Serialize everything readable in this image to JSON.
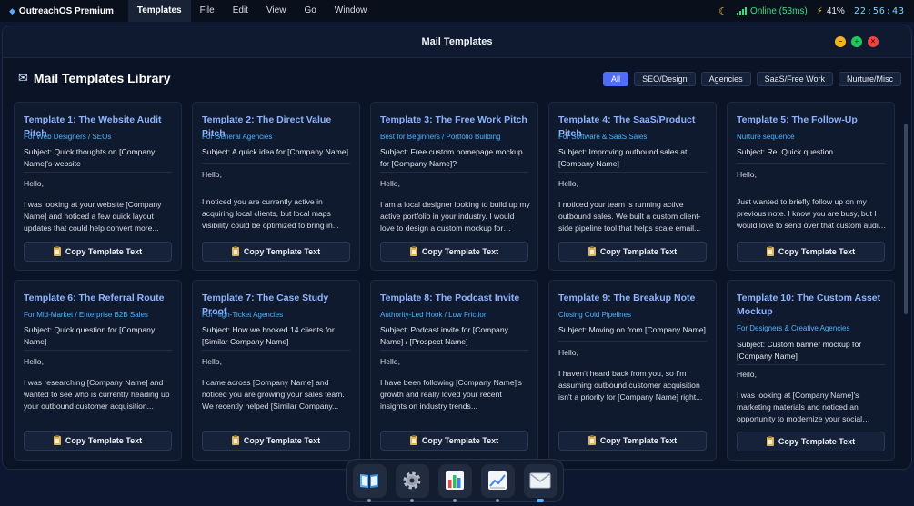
{
  "menubar": {
    "app_name": "OutreachOS Premium",
    "items": [
      "Templates",
      "File",
      "Edit",
      "View",
      "Go",
      "Window"
    ],
    "online": "Online (53ms)",
    "battery": "41%",
    "clock": "22:56:43"
  },
  "window": {
    "title": "Mail Templates",
    "buttons": {
      "minimize": "–",
      "maximize": "+",
      "close": "×"
    }
  },
  "library": {
    "title": "Mail Templates Library",
    "filters": [
      "All",
      "SEO/Design",
      "Agencies",
      "SaaS/Free Work",
      "Nurture/Misc"
    ],
    "active_filter": "All"
  },
  "copy_label": "Copy Template Text",
  "templates": [
    {
      "title": "Template 1: The Website Audit Pitch",
      "tag": "For Web Designers / SEOs",
      "subject": "Subject: Quick thoughts on [Company Name]'s website",
      "greeting": "Hello,",
      "body": "I was looking at your website [Company Name] and noticed a few quick layout updates that could help convert more..."
    },
    {
      "title": "Template 2: The Direct Value Pitch",
      "tag": "For General Agencies",
      "subject": "Subject: A quick idea for [Company Name]",
      "greeting": "Hello,",
      "body": "I noticed you are currently active in acquiring local clients, but local maps visibility could be optimized to bring in..."
    },
    {
      "title": "Template 3: The Free Work Pitch",
      "tag": "Best for Beginners / Portfolio Building",
      "subject": "Subject: Free custom homepage mockup for [Company Name]?",
      "greeting": "Hello,",
      "body": "I am a local designer looking to build up my active portfolio in your industry. I would love to design a custom mockup for [Company..."
    },
    {
      "title": "Template 4: The SaaS/Product Pitch",
      "tag": "For Software & SaaS Sales",
      "subject": "Subject: Improving outbound sales at [Company Name]",
      "greeting": "Hello,",
      "body": "I noticed your team is running active outbound sales. We built a custom client-side pipeline tool that helps scale email..."
    },
    {
      "title": "Template 5: The Follow-Up",
      "tag": "Nurture sequence",
      "subject": "Subject: Re: Quick question",
      "greeting": "Hello,",
      "body": "Just wanted to briefly follow up on my previous note. I know you are busy, but I would love to send over that custom audit ..."
    },
    {
      "title": "Template 6: The Referral Route",
      "tag": "For Mid-Market / Enterprise B2B Sales",
      "subject": "Subject: Quick question for [Company Name]",
      "greeting": "Hello,",
      "body": "I was researching [Company Name] and wanted to see who is currently heading up your outbound customer acquisition..."
    },
    {
      "title": "Template 7: The Case Study Proof",
      "tag": "For High-Ticket Agencies",
      "subject": "Subject: How we booked 14 clients for [Similar Company Name]",
      "greeting": "Hello,",
      "body": "I came across [Company Name] and noticed you are growing your sales team. We recently helped [Similar Company..."
    },
    {
      "title": "Template 8: The Podcast Invite",
      "tag": "Authority-Led Hook / Low Friction",
      "subject": "Subject: Podcast invite for [Company Name] / [Prospect Name]",
      "greeting": "Hello,",
      "body": "I have been following [Company Name]'s growth and really loved your recent insights on industry trends..."
    },
    {
      "title": "Template 9: The Breakup Note",
      "tag": "Closing Cold Pipelines",
      "subject": "Subject: Moving on from [Company Name]",
      "greeting": "Hello,",
      "body": "I haven't heard back from you, so I'm assuming outbound customer acquisition isn't a priority for [Company Name] right..."
    },
    {
      "title": "Template 10: The Custom Asset Mockup",
      "tag": "For Designers & Creative Agencies",
      "subject": "Subject: Custom banner mockup for [Company Name]",
      "greeting": "Hello,",
      "body": "I was looking at [Company Name]'s marketing materials and noticed an opportunity to modernize your social medi..."
    }
  ],
  "dock": [
    "library-icon",
    "settings-icon",
    "analytics-icon",
    "chart-icon",
    "mail-icon"
  ],
  "dock_active": "mail-icon"
}
